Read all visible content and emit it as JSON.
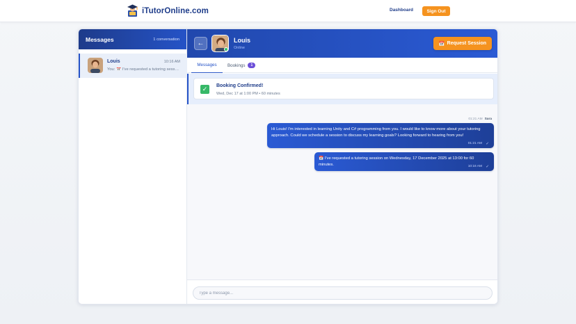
{
  "nav": {
    "brand": "iTutorOnline.com",
    "dashboard": "Dashboard",
    "sign_out": "Sign Out"
  },
  "sidebar": {
    "title": "Messages",
    "count": "1 conversation",
    "conversations": [
      {
        "name": "Louis",
        "time": "10:16 AM",
        "preview": "You: 📅 I've requested a tutoring session"
      }
    ]
  },
  "chat": {
    "back_icon": "←",
    "name": "Louis",
    "status": "Online",
    "request_button": "Request Session",
    "request_icon": "📅",
    "tabs": [
      {
        "label": "Messages"
      },
      {
        "label": "Bookings",
        "badge": "1"
      }
    ],
    "banner": {
      "title": "Booking Confirmed!",
      "subtitle": "Wed, Dec 17 at 1:00 PM • 60 minutes"
    },
    "thread_meta": {
      "time": "01:21 AM",
      "sender": "Sara"
    },
    "messages": [
      {
        "text": "Hi Louis! I'm interested in learning Unity and C# programming from you. I would like to know more about your tutoring approach. Could we schedule a session to discuss my learning goals? Looking forward to hearing from you!",
        "time": "01:21 AM"
      },
      {
        "text": "📅 I've requested a tutoring session on Wednesday, 17 December 2025 at 13:00 for 60 minutes.",
        "time": "10:16 AM"
      }
    ],
    "composer_placeholder": "Type a message..."
  },
  "colors": {
    "brand_blue": "#1f3d8a",
    "accent_orange": "#f5931f",
    "header_gradient_start": "#2148ad",
    "success_green": "#37b868",
    "badge_purple": "#6c4fd8"
  }
}
